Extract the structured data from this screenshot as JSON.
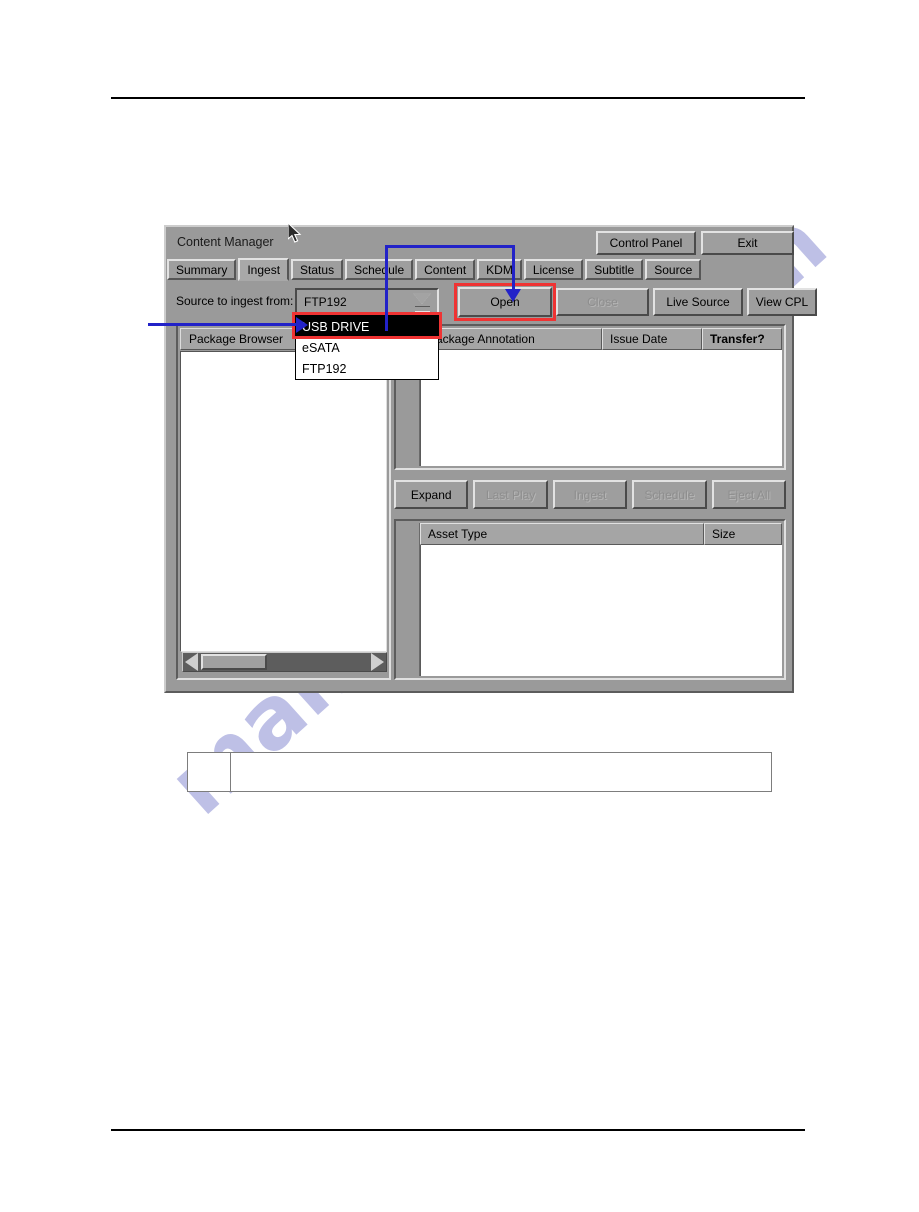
{
  "document": {
    "watermark": "manualshive.com"
  },
  "window": {
    "title": "Content Manager",
    "control_panel_label": "Control Panel",
    "exit_label": "Exit"
  },
  "tabs": [
    {
      "label": "Summary",
      "active": false
    },
    {
      "label": "Ingest",
      "active": true
    },
    {
      "label": "Status",
      "active": false
    },
    {
      "label": "Schedule",
      "active": false
    },
    {
      "label": "Content",
      "active": false
    },
    {
      "label": "KDM",
      "active": false
    },
    {
      "label": "License",
      "active": false
    },
    {
      "label": "Subtitle",
      "active": false
    },
    {
      "label": "Source",
      "active": false
    }
  ],
  "source_bar": {
    "label": "Source to ingest from:",
    "selected_value": "FTP192",
    "options": [
      {
        "label": "USB DRIVE",
        "selected": true
      },
      {
        "label": "eSATA",
        "selected": false
      },
      {
        "label": "FTP192",
        "selected": false
      }
    ],
    "buttons": [
      {
        "label": "Open",
        "enabled": true,
        "highlighted": true
      },
      {
        "label": "Close",
        "enabled": false,
        "highlighted": false
      },
      {
        "label": "Live Source",
        "enabled": true,
        "highlighted": false
      },
      {
        "label": "View CPL",
        "enabled": true,
        "highlighted": false
      }
    ]
  },
  "left_panel": {
    "header": "Package Browser",
    "rows": []
  },
  "package_table": {
    "columns": [
      "Package Annotation",
      "Issue Date",
      "Transfer?"
    ],
    "rows": []
  },
  "action_buttons": [
    {
      "label": "Expand",
      "enabled": true
    },
    {
      "label": "Last Play",
      "enabled": false
    },
    {
      "label": "Ingest",
      "enabled": false
    },
    {
      "label": "Schedule",
      "enabled": false
    },
    {
      "label": "Eject All",
      "enabled": false
    }
  ],
  "asset_table": {
    "columns": [
      "Asset Type",
      "Size"
    ],
    "rows": []
  },
  "note_table": {
    "number": "",
    "text": ""
  },
  "colors": {
    "highlight_red": "#ef3333",
    "annotation_blue": "#2222c8",
    "window_gray": "#9a9a9a",
    "watermark": "#b9bbe4"
  }
}
